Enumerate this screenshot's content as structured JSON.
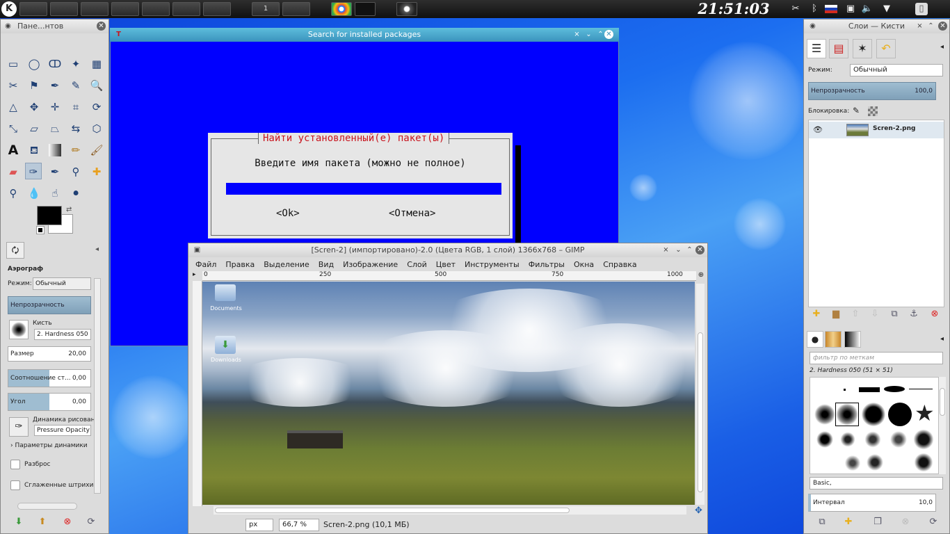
{
  "taskbar": {
    "clock": "21:51:03",
    "desktop_number": "1",
    "tray_icons": [
      "scissors-icon",
      "bluetooth-icon",
      "flag-icon",
      "network-icon",
      "volume-icon",
      "arrow-icon"
    ]
  },
  "toolbox": {
    "title": "Пане...нтов",
    "tool_title": "Аэрограф",
    "mode_label": "Режим:",
    "mode_value": "Обычный",
    "opacity_label": "Непрозрачность",
    "brush_label": "Кисть",
    "brush_value": "2. Hardness 050",
    "size_label": "Размер",
    "size_value": "20,00",
    "ratio_label": "Соотношение ст...",
    "ratio_value": "0,00",
    "angle_label": "Угол",
    "angle_value": "0,00",
    "dynamics_label": "Динамика рисован",
    "dynamics_value": "Pressure Opacity",
    "dynamics_params": "Параметры динамики",
    "scatter_label": "Разброс",
    "smooth_label": "Сглаженные штрихи"
  },
  "search_window": {
    "title": "Search for installed packages",
    "dialog_title": "Найти установленный(е) пакет(ы)",
    "prompt": "Введите имя пакета (можно не полное)",
    "ok": "<Ok>",
    "cancel": "<Отмена>"
  },
  "gimp": {
    "title": "[Scren-2] (импортировано)-2.0 (Цвета RGB, 1 слой) 1366x768 – GIMP",
    "menu": [
      "Файл",
      "Правка",
      "Выделение",
      "Вид",
      "Изображение",
      "Слой",
      "Цвет",
      "Инструменты",
      "Фильтры",
      "Окна",
      "Справка"
    ],
    "ruler_ticks": [
      "0",
      "250",
      "500",
      "750",
      "1000"
    ],
    "desktop_icons": [
      "Documents",
      "Downloads"
    ],
    "unit": "px",
    "zoom": "66,7 %",
    "status": "Scren-2.png (10,1 МБ)"
  },
  "rdock": {
    "title": "Слои — Кисти",
    "mode_label": "Режим:",
    "mode_value": "Обычный",
    "opacity_label": "Непрозрачность",
    "opacity_value": "100,0",
    "lock_label": "Блокировка:",
    "layer_name": "Scren-2.png",
    "filter_placeholder": "фильтр по меткам",
    "brush_name": "2. Hardness 050 (51 × 51)",
    "brush_set": "Basic,",
    "interval_label": "Интервал",
    "interval_value": "10,0"
  },
  "colors": {
    "accent": "#3b93bd",
    "terminal_blue": "#0000ff",
    "dialog_title_red": "#c8141e"
  }
}
